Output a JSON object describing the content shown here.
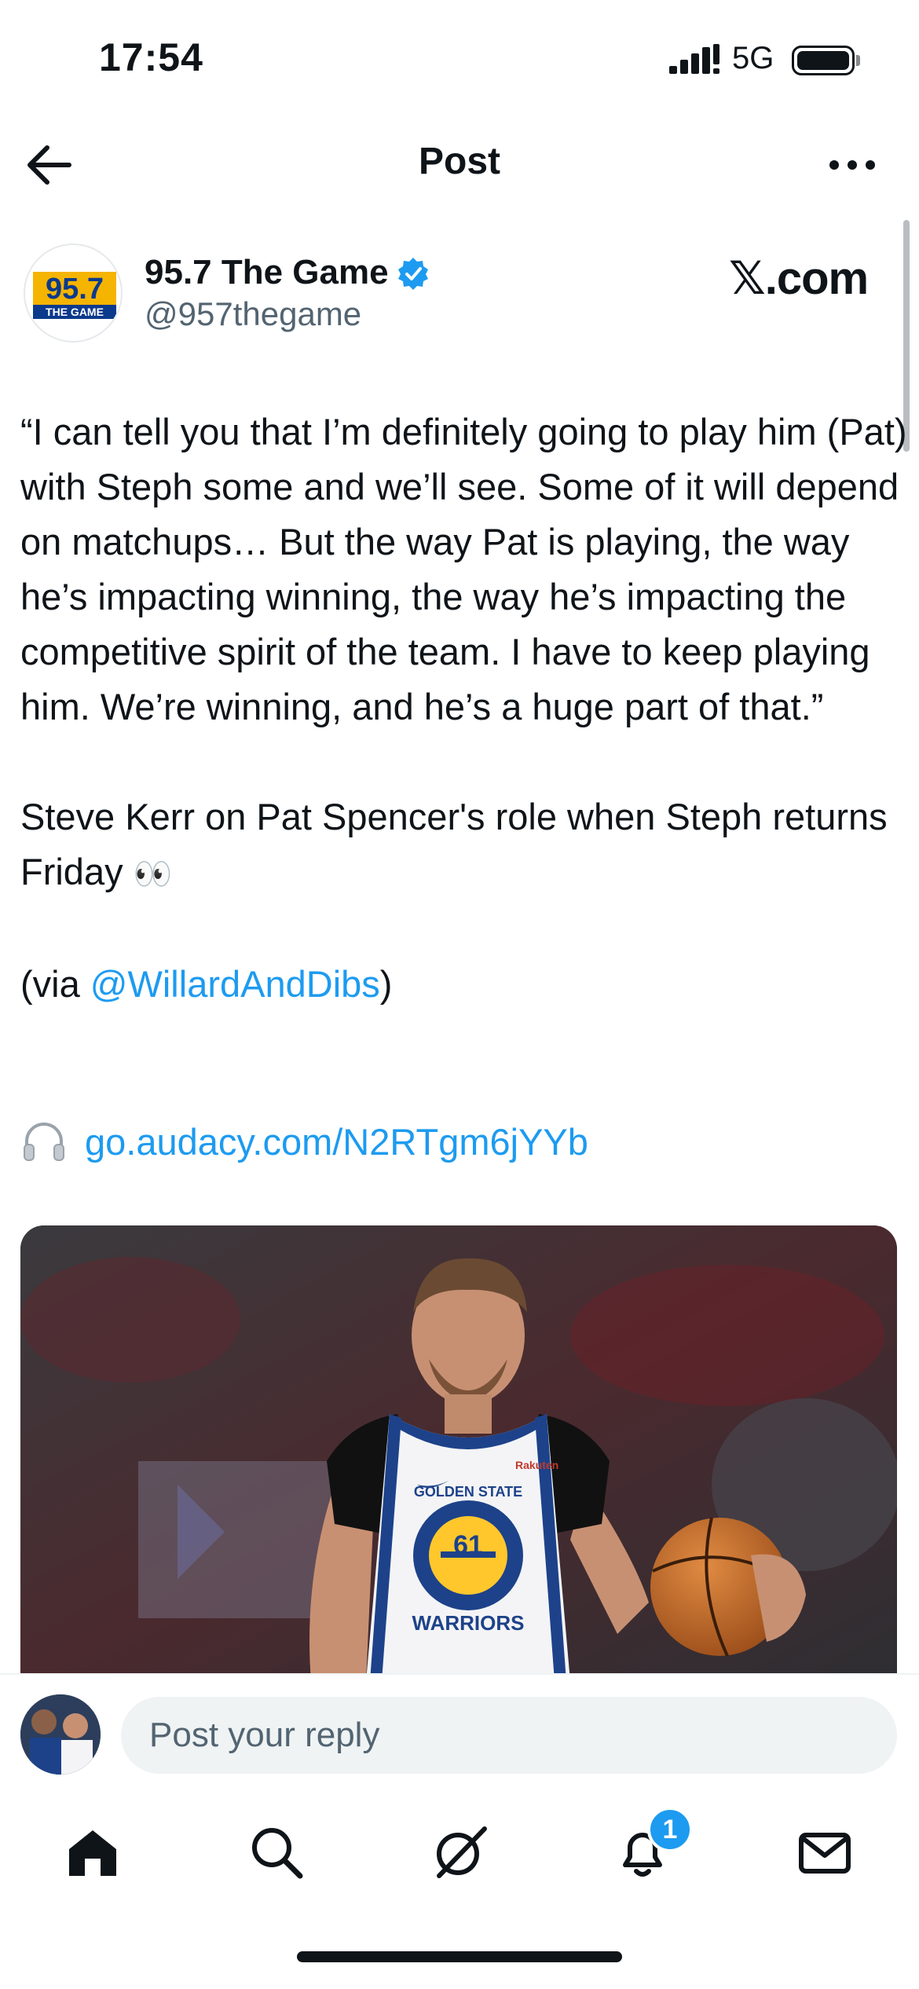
{
  "status_bar": {
    "time": "17:54",
    "network": "5G"
  },
  "nav": {
    "title": "Post"
  },
  "author": {
    "logo_number": "95.7",
    "logo_text": "THE GAME",
    "display_name": "95.7 The Game",
    "handle": "@957thegame",
    "source": "𝕏.com"
  },
  "post": {
    "quote": "“I can tell you that I’m definitely going to play him (Pat) with Steph some and we’ll see. Some of it will depend on matchups… But the way Pat is playing, the way he’s impacting winning, the way he’s impacting the competitive spirit of the team. I have to keep playing him. We’re winning, and he’s a huge part of that.”",
    "context": "Steve Kerr on Pat Spencer's role when Steph returns Friday",
    "emoji": "👀",
    "via_prefix": "(via ",
    "via_mention": "@WillardAndDibs",
    "via_suffix": ")",
    "audio_link": "go.audacy.com/N2RTgm6jYYb"
  },
  "media": {
    "jersey_brand": "Rakuten",
    "jersey_team_top": "GOLDEN STATE",
    "jersey_number": "61",
    "jersey_team_bottom": "WARRIORS"
  },
  "reply": {
    "placeholder": "Post your reply"
  },
  "tabbar": {
    "notifications_badge": "1"
  },
  "colors": {
    "accent": "#1d9bf0",
    "text": "#0f1419",
    "muted": "#536471"
  }
}
